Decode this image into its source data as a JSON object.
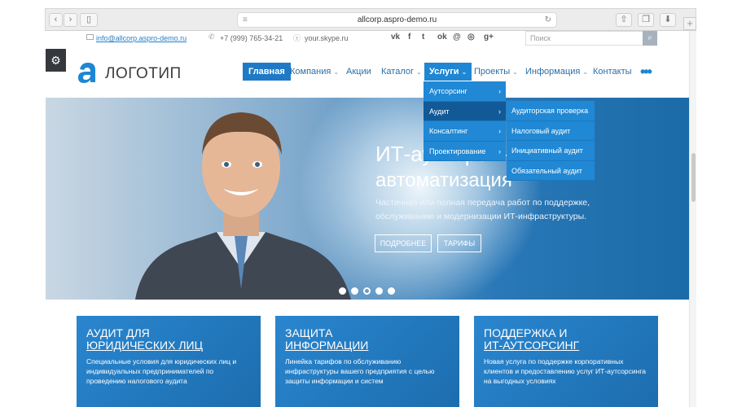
{
  "browser": {
    "url": "allcorp.aspro-demo.ru"
  },
  "topbar": {
    "email": "info@allcorp.aspro-demo.ru",
    "phone": "+7 (999) 765-34-21",
    "skype": "your.skype.ru",
    "social": [
      "vk",
      "f",
      "t",
      "ok",
      "@",
      "ig",
      "g+"
    ],
    "search_placeholder": "Поиск"
  },
  "header": {
    "logo_text": "ЛОГОТИП",
    "menu": [
      {
        "label": "Главная",
        "state": "active"
      },
      {
        "label": "Компания",
        "dropdown": true
      },
      {
        "label": "Акции"
      },
      {
        "label": "Каталог",
        "dropdown": true
      },
      {
        "label": "Услуги",
        "state": "open",
        "dropdown": true
      },
      {
        "label": "Проекты",
        "dropdown": true
      },
      {
        "label": "Информация",
        "dropdown": true
      },
      {
        "label": "Контакты"
      }
    ]
  },
  "dropdown": {
    "level1": [
      "Аутсорсинг",
      "Аудит",
      "Консалтинг",
      "Проектирование"
    ],
    "level1_highlight": 1,
    "level2": [
      "Аудиторская проверка",
      "Налоговый аудит",
      "Инициативный аудит",
      "Обязательный аудит"
    ]
  },
  "hero": {
    "title1": "ИТ-аутсорсинг и",
    "title2": "автоматизация",
    "subtitle": "Частичная или полная передача работ по поддержке, обслуживанию и модернизации ИТ-инфраструктуры.",
    "btn_more": "ПОДРОБНЕЕ",
    "btn_tariffs": "ТАРИФЫ",
    "slides": 5,
    "current_slide": 3
  },
  "cards": [
    {
      "title1": "АУДИТ ДЛЯ",
      "title2": "ЮРИДИЧЕСКИХ ЛИЦ",
      "desc": "Специальные условия для юридических лиц и индивидуальных предпринимателей по проведению налогового аудита"
    },
    {
      "title1": "ЗАЩИТА",
      "title2": "ИНФОРМАЦИИ",
      "desc": "Линейка тарифов по обслуживанию инфраструктуры вашего предприятия с целью защиты информации и систем"
    },
    {
      "title1": "ПОДДЕРЖКА И",
      "title2": "ИТ-АУТСОРСИНГ",
      "desc": "Новая услуга по поддержке корпоративных клиентов и предоставлению услуг ИТ-аутсорсинга на выгодных условиях"
    }
  ],
  "colors": {
    "accent": "#1e86d3",
    "menu_text": "#2c6ea6",
    "dark": "#35393e"
  }
}
